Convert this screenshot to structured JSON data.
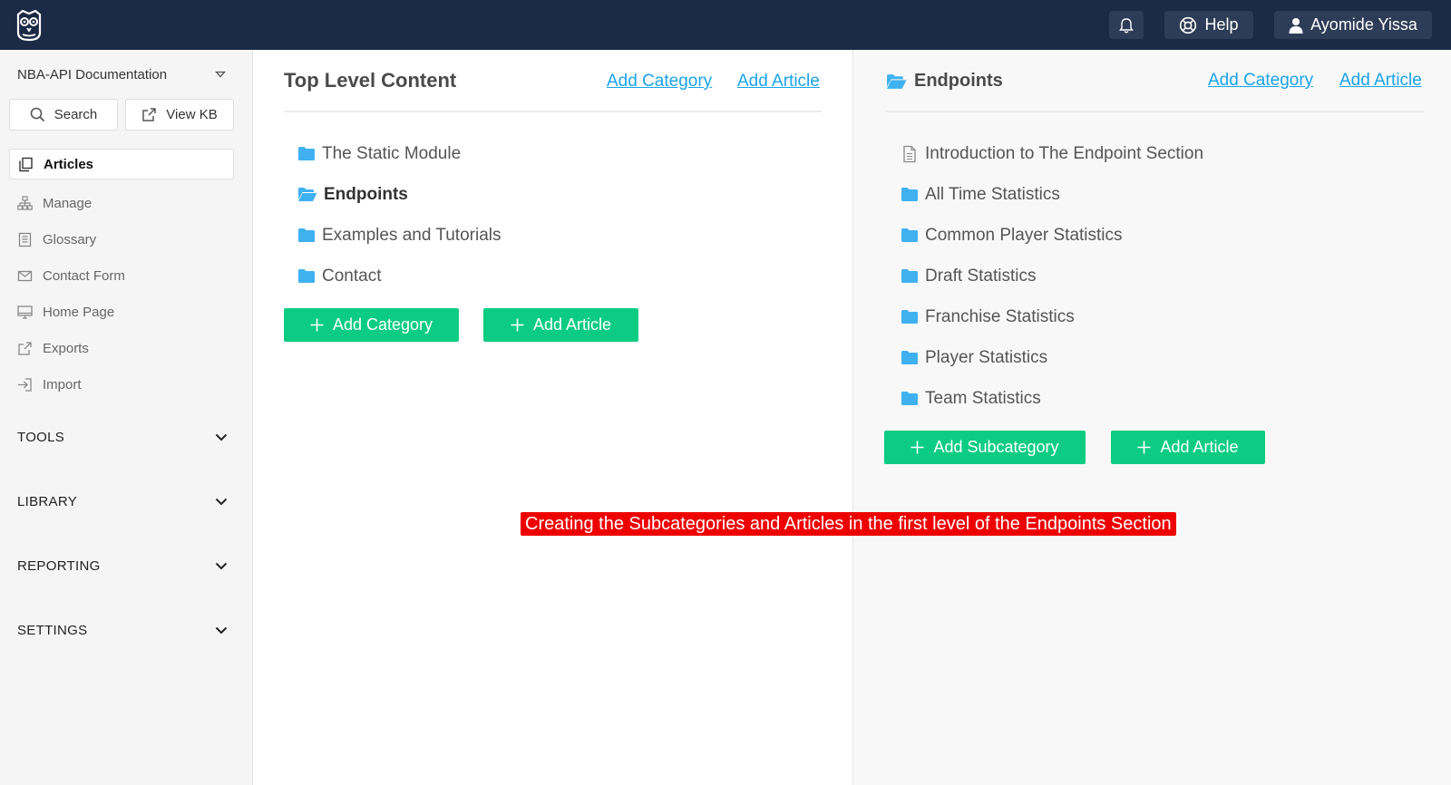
{
  "header": {
    "help_label": "Help",
    "user_name": "Ayomide Yissa"
  },
  "sidebar": {
    "kb_name": "NBA-API Documentation",
    "search_label": "Search",
    "viewkb_label": "View KB",
    "nav": [
      {
        "label": "Articles",
        "icon": "articles-icon"
      },
      {
        "label": "Manage",
        "icon": "sitemap-icon"
      },
      {
        "label": "Glossary",
        "icon": "book-icon"
      },
      {
        "label": "Contact Form",
        "icon": "envelope-icon"
      },
      {
        "label": "Home Page",
        "icon": "monitor-icon"
      },
      {
        "label": "Exports",
        "icon": "export-icon"
      },
      {
        "label": "Import",
        "icon": "import-icon"
      }
    ],
    "sections": [
      "TOOLS",
      "LIBRARY",
      "REPORTING",
      "SETTINGS"
    ]
  },
  "left_panel": {
    "title": "Top Level Content",
    "add_category_link": "Add Category",
    "add_article_link": "Add Article",
    "items": [
      {
        "label": "The Static Module",
        "type": "folder"
      },
      {
        "label": "Endpoints",
        "type": "folder-open"
      },
      {
        "label": "Examples and Tutorials",
        "type": "folder"
      },
      {
        "label": "Contact",
        "type": "folder"
      }
    ],
    "add_category_button": "Add Category",
    "add_article_button": "Add Article"
  },
  "right_panel": {
    "title": "Endpoints",
    "add_category_link": "Add Category",
    "add_article_link": "Add Article",
    "items": [
      {
        "label": "Introduction to The Endpoint Section",
        "type": "document"
      },
      {
        "label": "All Time Statistics",
        "type": "folder"
      },
      {
        "label": "Common Player Statistics",
        "type": "folder"
      },
      {
        "label": "Draft Statistics",
        "type": "folder"
      },
      {
        "label": "Franchise Statistics",
        "type": "folder"
      },
      {
        "label": "Player Statistics",
        "type": "folder"
      },
      {
        "label": "Team Statistics",
        "type": "folder"
      }
    ],
    "add_subcategory_button": "Add Subcategory",
    "add_article_button": "Add Article"
  },
  "caption": "Creating the Subcategories and Articles in the first level of the Endpoints Section",
  "colors": {
    "topbar": "#1b2a45",
    "accent_green": "#0ccc83",
    "link_blue": "#1aa3e8",
    "folder_blue": "#3fb1f0",
    "caption_red": "#ee0000"
  }
}
